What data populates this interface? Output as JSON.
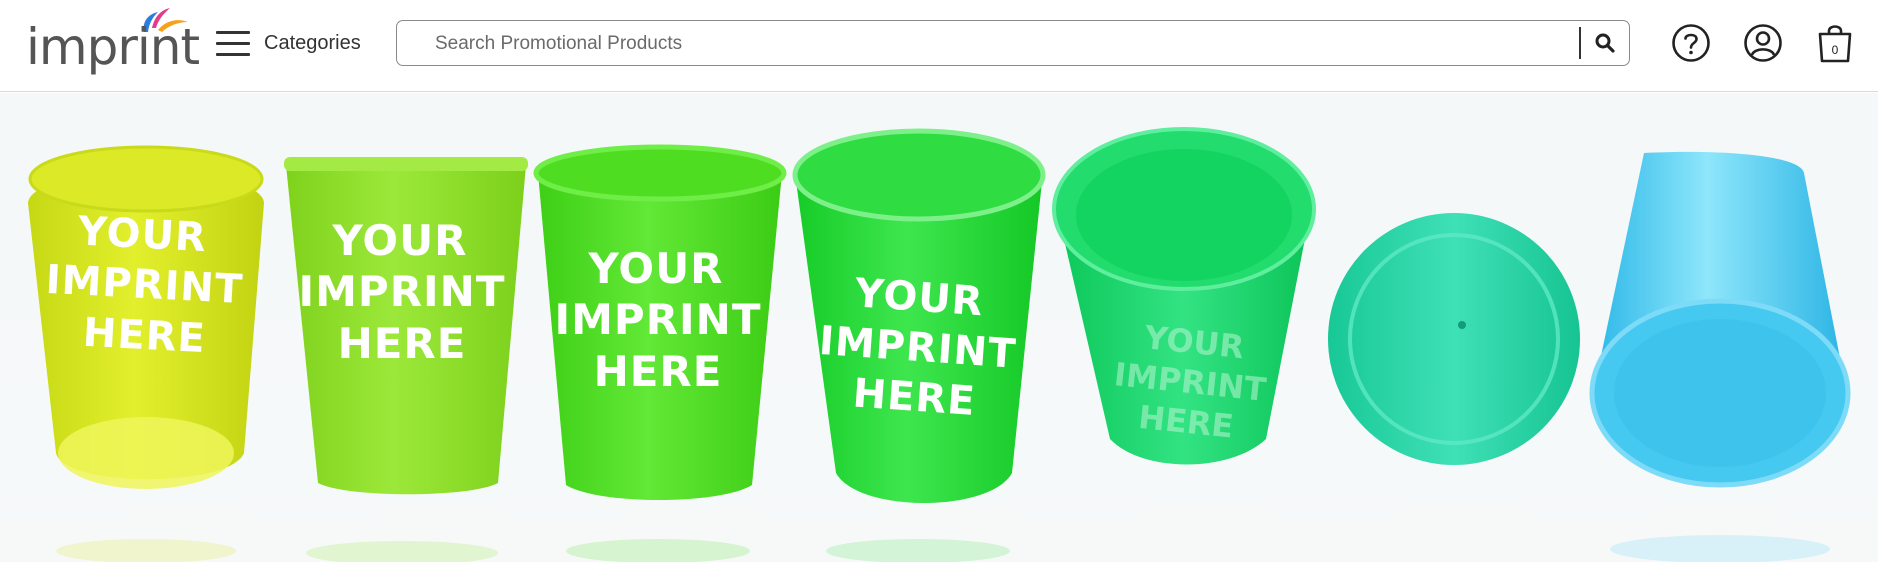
{
  "header": {
    "logo_text": "imprint",
    "menu_label": "Categories",
    "search": {
      "placeholder": "Search Promotional Products",
      "value": ""
    },
    "cart_count": "0"
  },
  "icons": {
    "menu": "hamburger-icon",
    "search": "search-icon",
    "help": "question-circle-icon",
    "account": "user-circle-icon",
    "cart": "shopping-bag-icon"
  },
  "hero": {
    "imprint_lines": [
      "YOUR",
      "IMPRINT",
      "HERE"
    ],
    "cup_colors": [
      "#d4e31c",
      "#8fe22a",
      "#4fe023",
      "#27d83a",
      "#14d86a",
      "#22d6a6",
      "#3fc8ee"
    ]
  },
  "colors": {
    "logo_blue": "#2a7de1",
    "logo_pink": "#e23c8a",
    "logo_orange": "#f6a11b"
  }
}
